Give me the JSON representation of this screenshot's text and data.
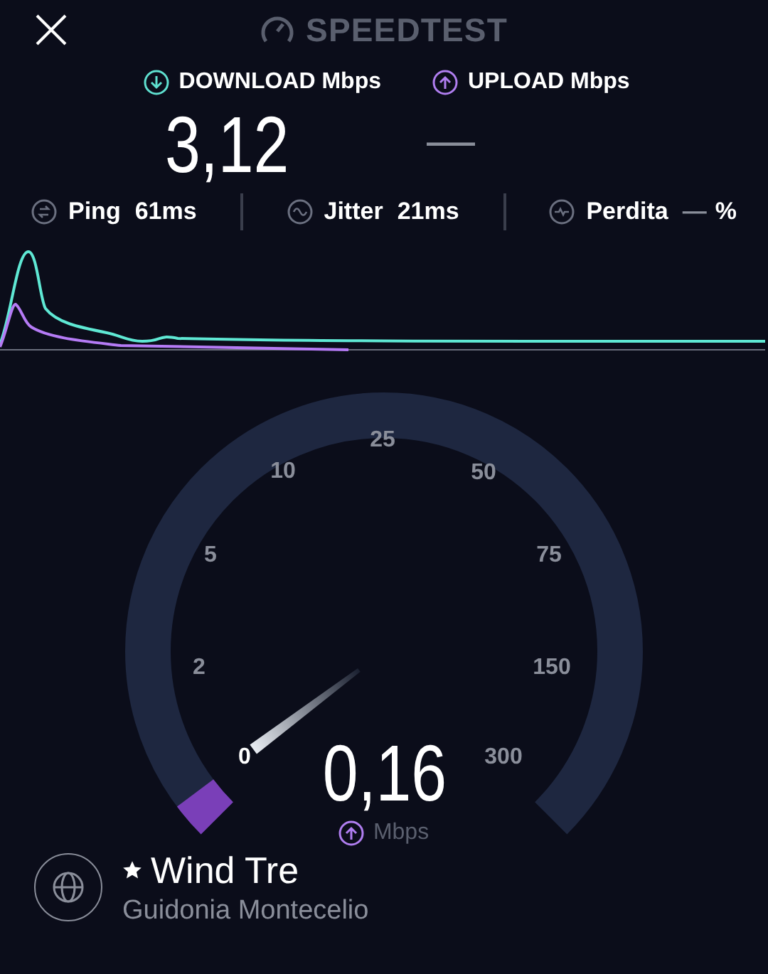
{
  "header": {
    "title": "SPEEDTEST"
  },
  "results": [
    {
      "kind": "download",
      "label": "DOWNLOAD Mbps",
      "value": "3,12"
    },
    {
      "kind": "upload",
      "label": "UPLOAD Mbps",
      "value": "—"
    }
  ],
  "metrics": [
    {
      "kind": "ping",
      "label": "Ping",
      "value": "61ms"
    },
    {
      "kind": "jitter",
      "label": "Jitter",
      "value": "21ms"
    },
    {
      "kind": "loss",
      "label": "Perdita",
      "value": "—",
      "unit": "%"
    }
  ],
  "gauge": {
    "ticks": [
      "0",
      "2",
      "5",
      "10",
      "25",
      "50",
      "75",
      "150",
      "300"
    ],
    "reading": "0,16",
    "unit": "Mbps"
  },
  "server": {
    "favorite": true,
    "name": "Wind Tre",
    "location": "Guidonia Montecelio"
  }
}
